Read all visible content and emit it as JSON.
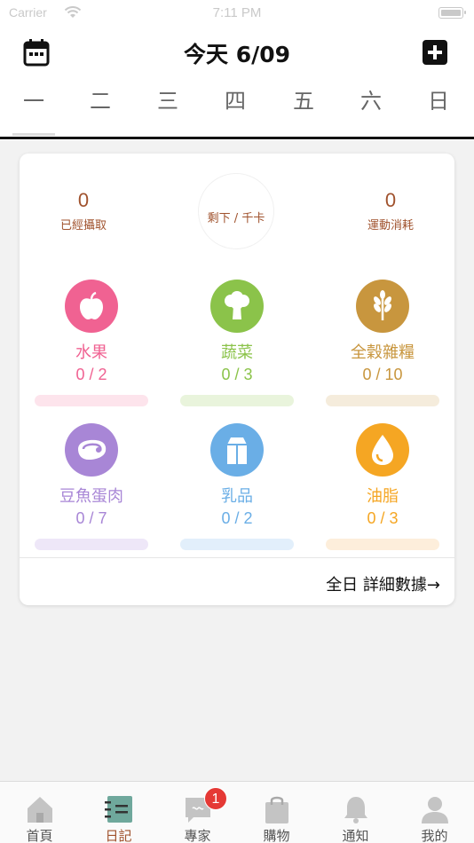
{
  "status_bar": {
    "carrier": "Carrier",
    "time": "7:11 PM"
  },
  "header": {
    "title": "今天 6/09"
  },
  "week_days": [
    "一",
    "二",
    "三",
    "四",
    "五",
    "六",
    "日"
  ],
  "summary": {
    "consumed": {
      "value": "0",
      "label": "已經攝取"
    },
    "remaining": {
      "label": "剩下 / 千卡"
    },
    "exercise": {
      "value": "0",
      "label": "運動消耗"
    }
  },
  "food_groups": [
    {
      "name": "水果",
      "count": "0 / 2",
      "color": "#f06292",
      "bar": "#fde4ec",
      "icon": "apple-icon"
    },
    {
      "name": "蔬菜",
      "count": "0 / 3",
      "color": "#8bc34a",
      "bar": "#e9f4dc",
      "icon": "broccoli-icon"
    },
    {
      "name": "全穀雜糧",
      "count": "0 / 10",
      "color": "#c8963e",
      "bar": "#f5ecdc",
      "icon": "wheat-icon"
    },
    {
      "name": "豆魚蛋肉",
      "count": "0 / 7",
      "color": "#a886d6",
      "bar": "#eee7f8",
      "icon": "meat-icon"
    },
    {
      "name": "乳品",
      "count": "0 / 2",
      "color": "#6aaee6",
      "bar": "#e2effb",
      "icon": "milk-icon"
    },
    {
      "name": "油脂",
      "count": "0 / 3",
      "color": "#f5a623",
      "bar": "#fdeedb",
      "icon": "oil-drop-icon"
    }
  ],
  "detail_link": "全日 詳細數據→",
  "tabs": [
    {
      "label": "首頁",
      "icon": "home-icon"
    },
    {
      "label": "日記",
      "icon": "diary-icon"
    },
    {
      "label": "專家",
      "icon": "chat-icon",
      "badge": "1"
    },
    {
      "label": "購物",
      "icon": "shopping-bag-icon"
    },
    {
      "label": "通知",
      "icon": "bell-icon"
    },
    {
      "label": "我的",
      "icon": "profile-icon"
    }
  ],
  "colors": {
    "accent": "#a0522d",
    "active_tab": "#a0522d"
  }
}
